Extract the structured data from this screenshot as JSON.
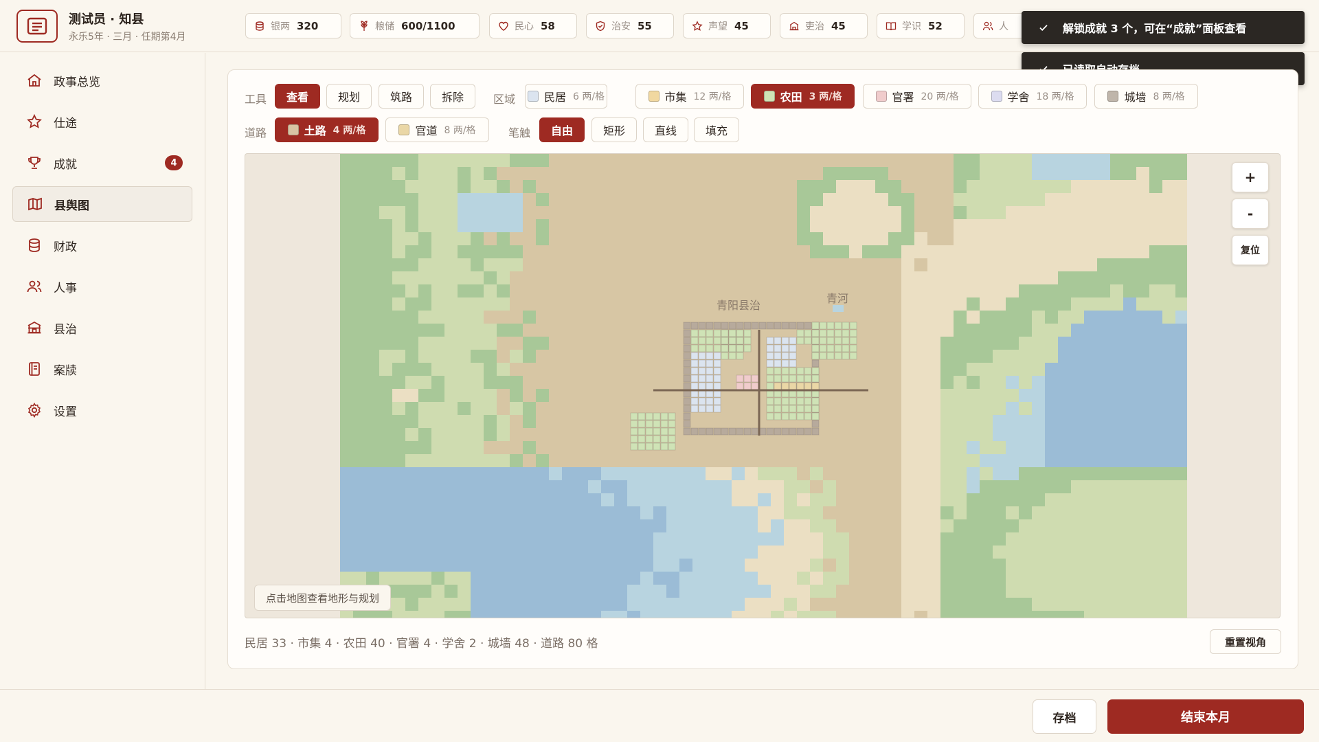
{
  "header": {
    "title": "测试员 · 知县",
    "subtitle": "永乐5年 · 三月 · 任期第4月",
    "stats": [
      {
        "icon": "silver-coins-icon",
        "label": "银两",
        "value": "320"
      },
      {
        "icon": "grain-icon",
        "label": "粮储",
        "value": "600/1100"
      },
      {
        "icon": "heart-icon",
        "label": "民心",
        "value": "58"
      },
      {
        "icon": "shield-icon",
        "label": "治安",
        "value": "55"
      },
      {
        "icon": "star-icon",
        "label": "声望",
        "value": "45"
      },
      {
        "icon": "yamen-icon",
        "label": "吏治",
        "value": "45"
      },
      {
        "icon": "book-icon",
        "label": "学识",
        "value": "52"
      },
      {
        "icon": "people-icon",
        "label": "人",
        "value": ""
      }
    ]
  },
  "toasts": [
    {
      "text": "解锁成就 3 个，可在“成就”面板查看"
    },
    {
      "text": "已读取自动存档"
    }
  ],
  "sidebar": {
    "items": [
      {
        "label": "政事总览",
        "icon": "home-icon"
      },
      {
        "label": "仕途",
        "icon": "star-icon"
      },
      {
        "label": "成就",
        "icon": "trophy-icon",
        "badge": "4"
      },
      {
        "label": "县舆图",
        "icon": "map-icon",
        "active": true
      },
      {
        "label": "财政",
        "icon": "coins-icon"
      },
      {
        "label": "人事",
        "icon": "people-icon"
      },
      {
        "label": "县治",
        "icon": "yamen-icon"
      },
      {
        "label": "案牍",
        "icon": "document-icon"
      },
      {
        "label": "设置",
        "icon": "gear-icon"
      }
    ]
  },
  "toolbar": {
    "tools_label": "工具",
    "tools": [
      {
        "label": "查看",
        "selected": true
      },
      {
        "label": "规划"
      },
      {
        "label": "筑路"
      },
      {
        "label": "拆除"
      }
    ],
    "zones_label": "区域",
    "zones": [
      {
        "label": "民居",
        "price": "6 两/格",
        "color": "#dbe4ef"
      },
      {
        "label": "市集",
        "price": "12 两/格",
        "color": "#f1d8a0"
      },
      {
        "label": "农田",
        "price": "3 两/格",
        "color": "#cfe3b6",
        "selected": true
      },
      {
        "label": "官署",
        "price": "20 两/格",
        "color": "#f0cccc"
      },
      {
        "label": "学舍",
        "price": "18 两/格",
        "color": "#dcdcf0"
      },
      {
        "label": "城墙",
        "price": "8 两/格",
        "color": "#bfb5aa"
      }
    ],
    "roads_label": "道路",
    "roads": [
      {
        "label": "土路",
        "price": "4 两/格",
        "color": "#d8c4a4",
        "selected": true
      },
      {
        "label": "官道",
        "price": "8 两/格",
        "color": "#ead7a6"
      }
    ],
    "brush_label": "笔触",
    "brushes": [
      {
        "label": "自由",
        "selected": true
      },
      {
        "label": "矩形"
      },
      {
        "label": "直线"
      },
      {
        "label": "填充"
      }
    ]
  },
  "map": {
    "labels": [
      "青阳县治",
      "青河"
    ],
    "zoom_in": "+",
    "zoom_out": "-",
    "reset": "复位",
    "hint": "点击地图查看地形与规划",
    "colors": {
      "plain": "#d7c6a4",
      "sand": "#ebdfc3",
      "meadow": "#cfdcb0",
      "forest": "#a8c898",
      "shallow": "#b8d4e0",
      "deep": "#9bbcd6",
      "wall": "#b7aa9c",
      "farm": "#cfe3b6",
      "house": "#dbe4ef",
      "office": "#f0cccc",
      "school": "#dcdcf0",
      "road": "#7a6654",
      "highway": "#ead7a6"
    }
  },
  "summary": "民居 33 · 市集 4 · 农田 40 · 官署 4 · 学舍 2 · 城墙 48 · 道路 80 格",
  "reset_view": "重置视角",
  "footer": {
    "save": "存档",
    "end_month": "结束本月"
  }
}
